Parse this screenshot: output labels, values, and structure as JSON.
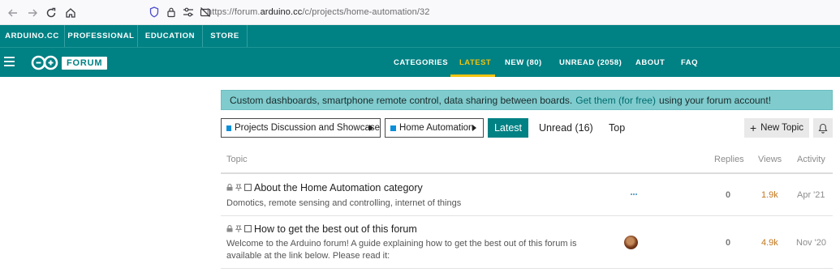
{
  "browser": {
    "url_prefix": "https://forum.",
    "url_domain": "arduino.cc",
    "url_path": "/c/projects/home-automation/32",
    "icons": [
      "back-icon",
      "forward-icon",
      "reload-icon",
      "home-icon",
      "shield-icon",
      "lock-icon",
      "permissions-icon",
      "camera-blocked-icon"
    ]
  },
  "topbar": {
    "items": [
      "ARDUINO.CC",
      "PROFESSIONAL",
      "EDUCATION",
      "STORE"
    ]
  },
  "forum_header": {
    "logo_text": "FORUM",
    "menu": [
      "CATEGORIES",
      "LATEST",
      "NEW (80)",
      "UNREAD (2058)",
      "ABOUT",
      "FAQ"
    ],
    "active_menu": "LATEST"
  },
  "banner": {
    "text_before": "Custom dashboards, smartphone remote control, data sharing between boards.",
    "link_text": "Get them (for free)",
    "text_after": "using your forum account!"
  },
  "controls": {
    "category_dropdown": "Projects Discussion and Showcase",
    "subcategory_dropdown": "Home Automation",
    "tabs": [
      "Latest",
      "Unread (16)",
      "Top"
    ],
    "active_tab": "Latest",
    "new_topic_label": "New Topic"
  },
  "table": {
    "headers": {
      "topic": "Topic",
      "replies": "Replies",
      "views": "Views",
      "activity": "Activity"
    },
    "rows": [
      {
        "title": "About the Home Automation category",
        "excerpt": "Domotics, remote sensing and controlling, internet of things",
        "replies": "0",
        "views": "1.9k",
        "activity": "Apr '21"
      },
      {
        "title": "How to get the best out of this forum",
        "excerpt": "Welcome to the Arduino forum! A guide explaining how to get the best out of this forum is available at the link below. Please read it:",
        "replies": "0",
        "views": "4.9k",
        "activity": "Nov '20"
      }
    ]
  },
  "colors": {
    "brand_teal": "#008184",
    "active_menu": "#f1c40f",
    "banner_bg": "#7fcbcd",
    "category_square": "#0a8fd8",
    "views_orange": "#c2761d"
  }
}
